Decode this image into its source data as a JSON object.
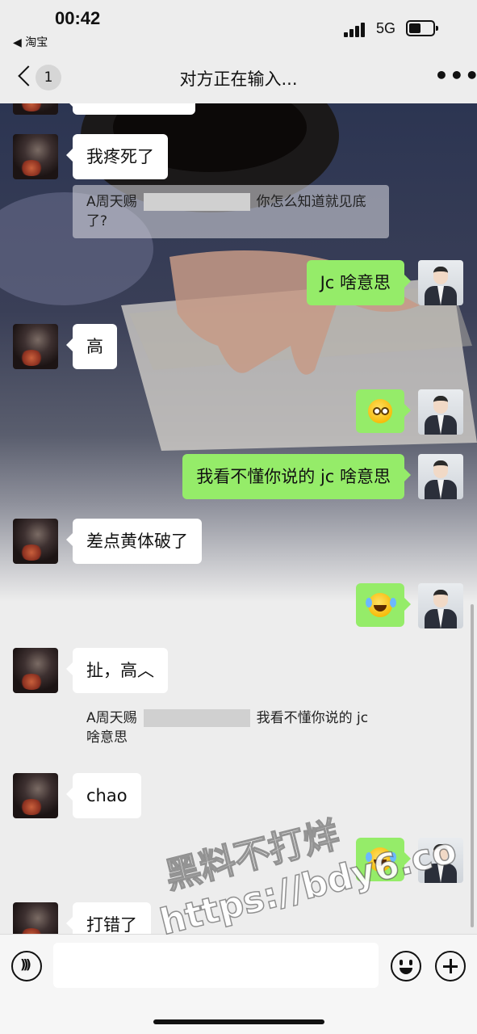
{
  "status_bar": {
    "time": "00:42",
    "back_app": "◀ 淘宝",
    "network": "5G"
  },
  "nav": {
    "unread_count": "1",
    "title": "对方正在输入...",
    "more": "•••"
  },
  "messages": [
    {
      "from": "them",
      "text": "我疼死了"
    },
    {
      "from": "them_quote",
      "prefix": "A周天赐",
      "text": "你怎么知道就见底了?"
    },
    {
      "from": "me",
      "text": "Jc 啥意思"
    },
    {
      "from": "them",
      "text": "高"
    },
    {
      "from": "me",
      "emoji": "flushed-emoji"
    },
    {
      "from": "me",
      "text": "我看不懂你说的 jc 啥意思"
    },
    {
      "from": "them",
      "text": "差点黄体破了"
    },
    {
      "from": "me",
      "emoji": "tears-of-joy-emoji"
    },
    {
      "from": "them",
      "text": "扯，高︿"
    },
    {
      "from": "them_quote",
      "prefix": "A周天赐",
      "text": "我看不懂你说的 jc",
      "text2": "啥意思"
    },
    {
      "from": "them",
      "text": "chao"
    },
    {
      "from": "me",
      "emoji": "tears-of-joy-emoji"
    },
    {
      "from": "them",
      "text": "打错了"
    }
  ],
  "watermark": {
    "line1": "黑料不打烊",
    "line2": "https://bdy6.co"
  },
  "input": {
    "value": ""
  },
  "colors": {
    "bubble_me": "#95ec69",
    "bubble_them": "#ffffff",
    "chrome": "#ededed"
  }
}
